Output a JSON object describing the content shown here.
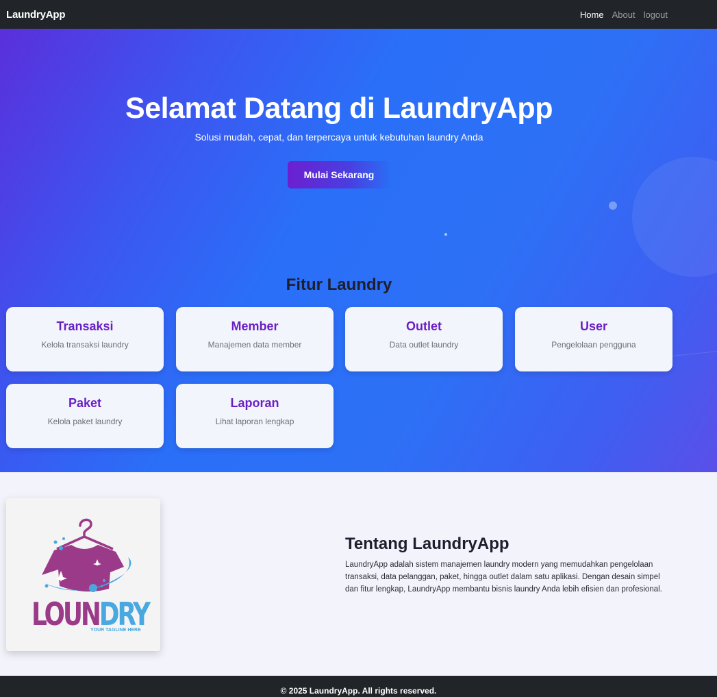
{
  "navbar": {
    "brand": "LaundryApp",
    "links": [
      {
        "label": "Home",
        "active": true
      },
      {
        "label": "About",
        "active": false
      },
      {
        "label": "logout",
        "active": false
      }
    ]
  },
  "hero": {
    "title": "Selamat Datang di LaundryApp",
    "subtitle": "Solusi mudah, cepat, dan terpercaya untuk kebutuhan laundry Anda",
    "cta_label": "Mulai Sekarang"
  },
  "features": {
    "title": "Fitur Laundry",
    "cards": [
      {
        "title": "Transaksi",
        "desc": "Kelola transaksi laundry"
      },
      {
        "title": "Member",
        "desc": "Manajemen data member"
      },
      {
        "title": "Outlet",
        "desc": "Data outlet laundry"
      },
      {
        "title": "User",
        "desc": "Pengelolaan pengguna"
      },
      {
        "title": "Paket",
        "desc": "Kelola paket laundry"
      },
      {
        "title": "Laporan",
        "desc": "Lihat laporan lengkap"
      }
    ]
  },
  "about": {
    "title": "Tentang LaundryApp",
    "text": "LaundryApp adalah sistem manajemen laundry modern yang memudahkan pengelolaan transaksi, data pelanggan, paket, hingga outlet dalam satu aplikasi. Dengan desain simpel dan fitur lengkap, LaundryApp membantu bisnis laundry Anda lebih efisien dan profesional.",
    "logo": {
      "word_left": "LOUN",
      "word_right": "DRY",
      "tagline": "YOUR TAGLINE HERE"
    }
  },
  "footer": {
    "text": "© 2025 LaundryApp. All rights reserved."
  },
  "colors": {
    "navbar": "#212529",
    "card_title": "#6a1fc4",
    "logo_purple": "#9b3a88",
    "logo_blue": "#4aa8e0"
  }
}
